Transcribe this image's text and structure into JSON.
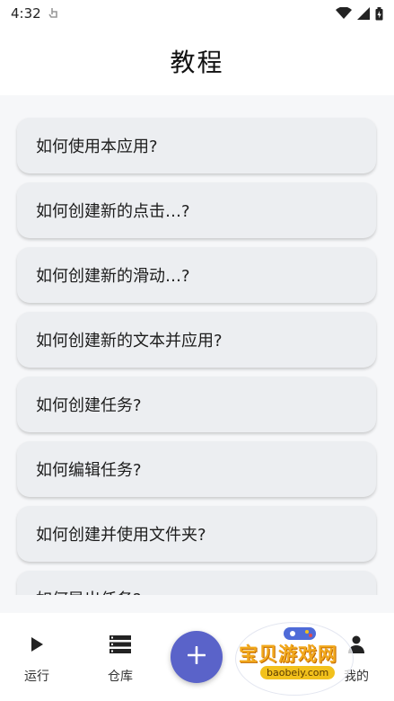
{
  "status_bar": {
    "time": "4:32",
    "icons": [
      "touch-icon",
      "wifi-icon",
      "signal-icon",
      "battery-icon"
    ]
  },
  "header": {
    "title": "教程"
  },
  "tutorials": [
    "如何使用本应用?",
    "如何创建新的点击…?",
    "如何创建新的滑动…?",
    "如何创建新的文本并应用?",
    "如何创建任务?",
    "如何编辑任务?",
    "如何创建并使用文件夹?",
    "如何导出任务?"
  ],
  "bottom_nav": {
    "run": "运行",
    "repository": "仓库",
    "mine": "我的",
    "fab_icon": "plus-icon"
  },
  "watermark": {
    "text": "宝贝游戏网",
    "url": "baobeiy.com"
  },
  "colors": {
    "accent": "#5a63c9",
    "card_bg": "#eceef1",
    "page_bg": "#f6f7f9"
  }
}
